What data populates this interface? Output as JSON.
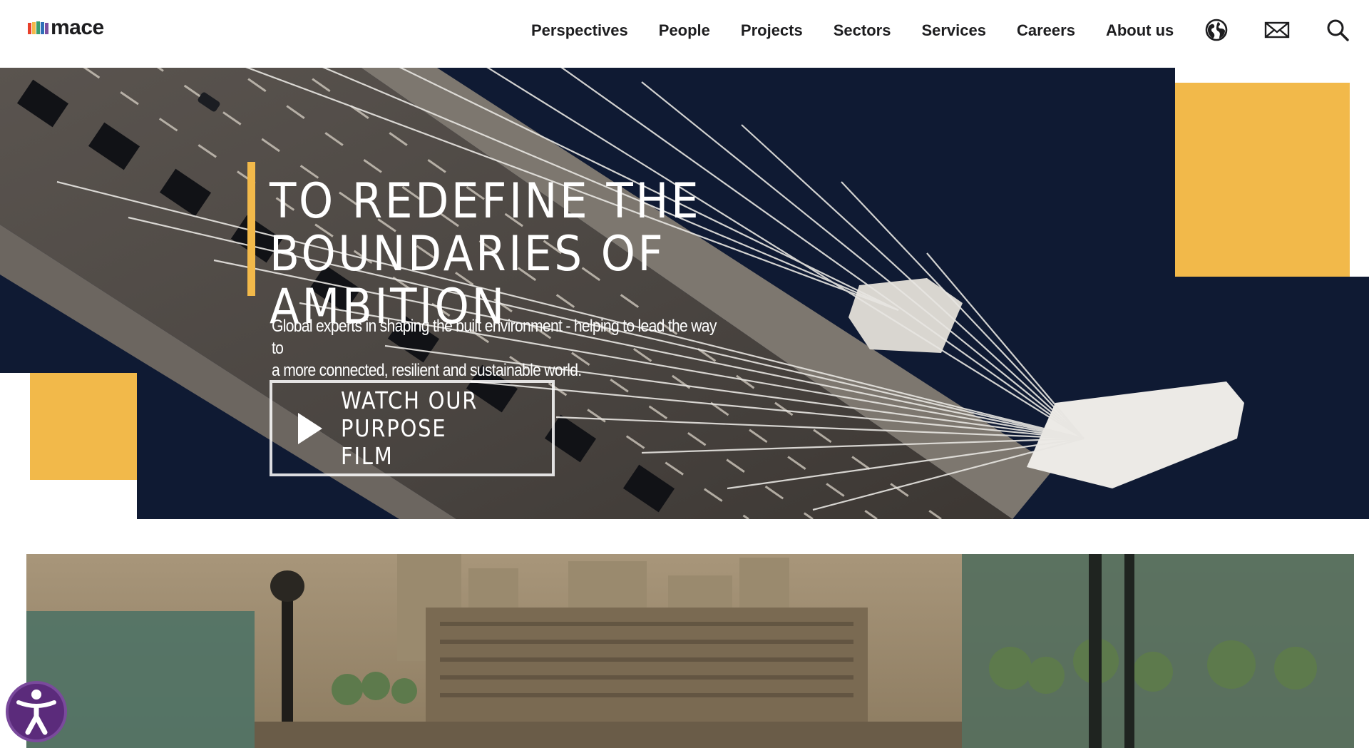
{
  "header": {
    "logo_text": "mace",
    "logo_bar_colors": [
      "#e8402b",
      "#f2b94a",
      "#3a9e6e",
      "#2f6fb8",
      "#7b4fa0"
    ],
    "nav": [
      {
        "label": "Perspectives"
      },
      {
        "label": "People"
      },
      {
        "label": "Projects"
      },
      {
        "label": "Sectors"
      },
      {
        "label": "Services"
      },
      {
        "label": "Careers"
      },
      {
        "label": "About us"
      }
    ],
    "icons": [
      "globe-icon",
      "mail-icon",
      "search-icon"
    ]
  },
  "hero": {
    "title_line1": "TO REDEFINE THE",
    "title_line2": "BOUNDARIES OF AMBITION",
    "subtitle_line1": "Global experts in shaping the built environment - helping to lead the way to",
    "subtitle_line2": "a more connected, resilient and sustainable world.",
    "cta_line1": "WATCH OUR",
    "cta_line2": "PURPOSE FILM",
    "accent_color": "#f2b94a",
    "background_color": "#0f1a33"
  },
  "accessibility": {
    "icon": "accessibility-icon",
    "color": "#5b2b7b"
  }
}
